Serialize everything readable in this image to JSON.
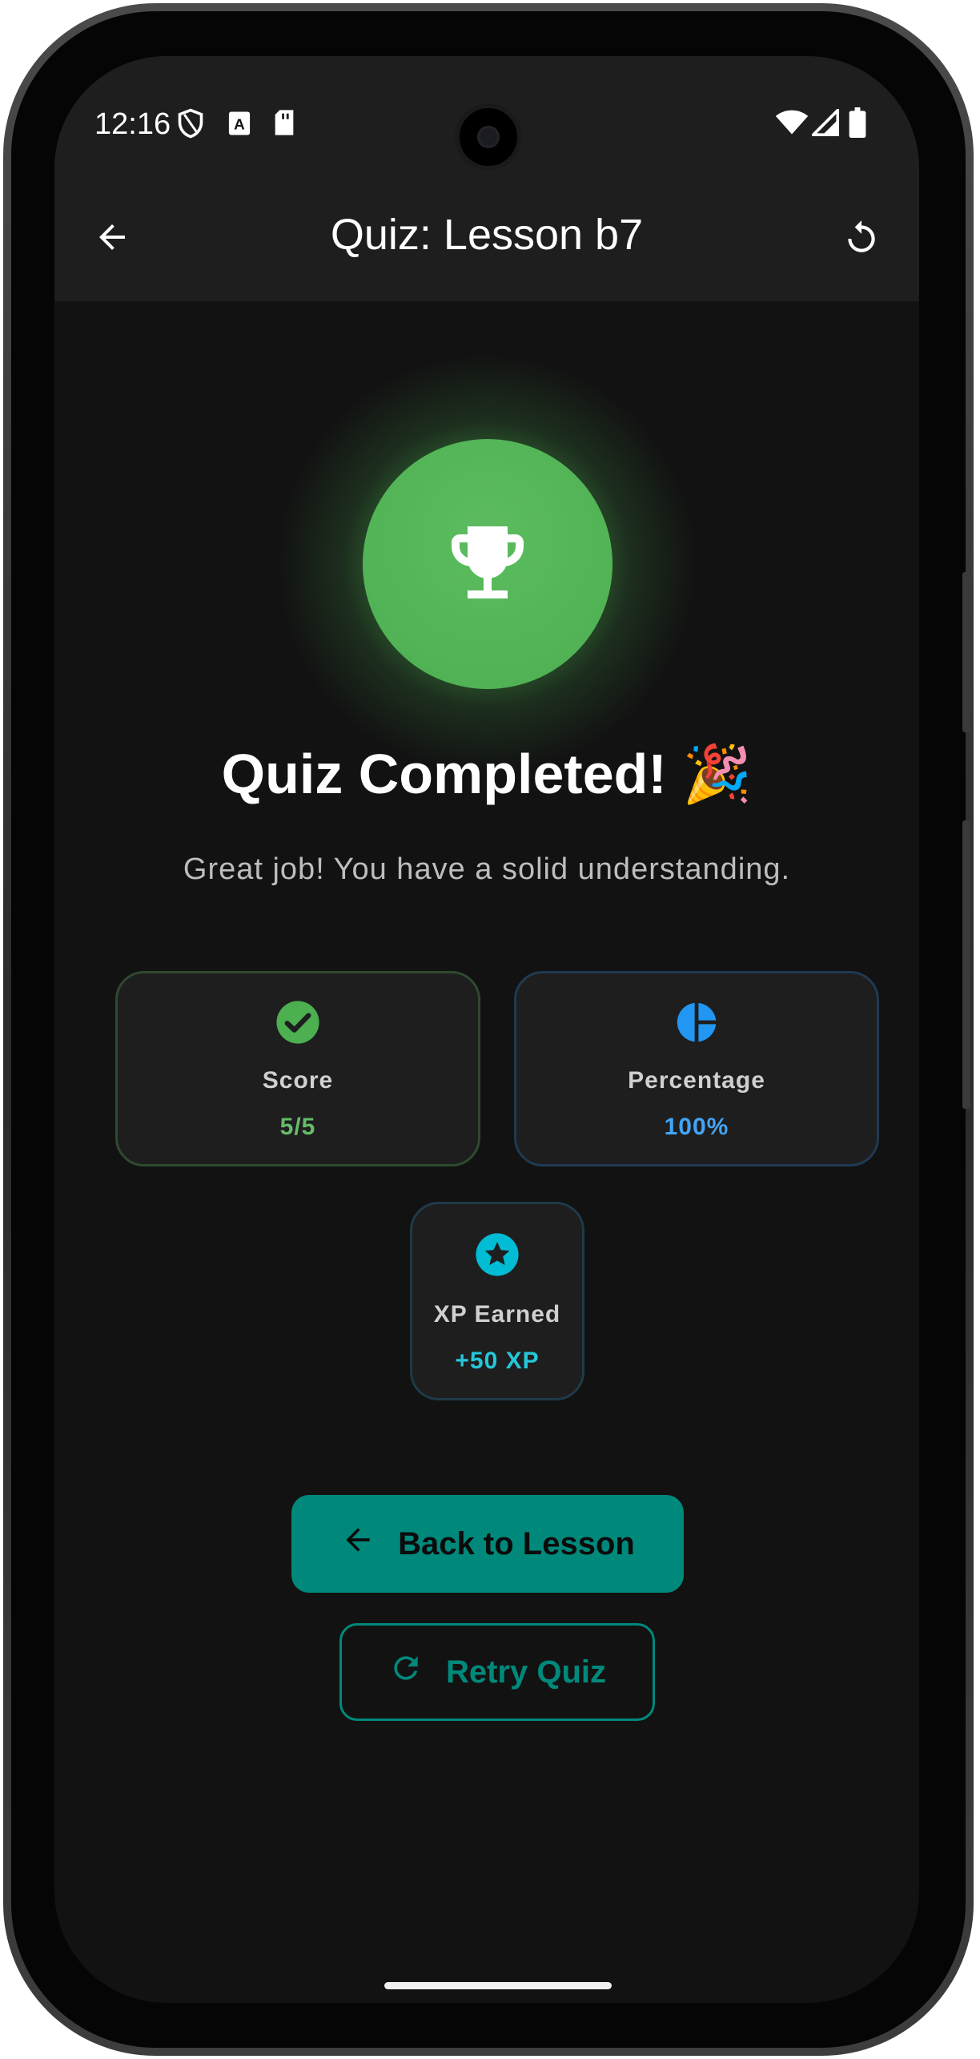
{
  "status_bar": {
    "time": "12:16",
    "left_icons": [
      "shield-icon",
      "text-app-icon",
      "sd-card-icon"
    ],
    "right_icons": [
      "wifi-icon",
      "signal-icon",
      "battery-icon"
    ]
  },
  "app_bar": {
    "title": "Quiz: Lesson b7",
    "back_icon": "arrow-left-icon",
    "refresh_icon": "refresh-icon"
  },
  "result": {
    "icon": "trophy-icon",
    "headline": "Quiz Completed! 🎉",
    "message": "Great job! You have a solid understanding."
  },
  "stats": {
    "score": {
      "label": "Score",
      "value": "5/5",
      "icon": "check-circle-icon",
      "color": "#4caf50"
    },
    "percentage": {
      "label": "Percentage",
      "value": "100%",
      "icon": "pie-chart-icon",
      "color": "#2196f3"
    },
    "xp": {
      "label": "XP Earned",
      "value": "+50 XP",
      "icon": "star-badge-icon",
      "color": "#00bcd4"
    }
  },
  "actions": {
    "back_label": "Back to Lesson",
    "retry_label": "Retry Quiz"
  },
  "colors": {
    "accent": "#00897b",
    "background": "#121212",
    "surface": "#1e1e1e",
    "success": "#4caf50"
  }
}
